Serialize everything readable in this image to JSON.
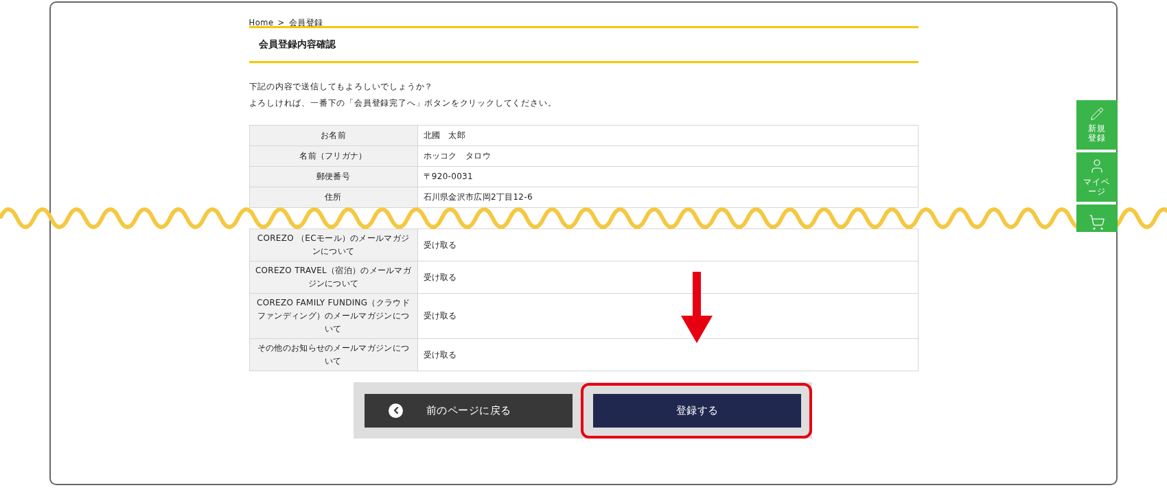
{
  "breadcrumb": {
    "items": [
      "Home",
      "会員登録"
    ],
    "separator": ">"
  },
  "page_title": "会員登録内容確認",
  "intro": [
    "下記の内容で送信してもよろしいでしょうか？",
    "よろしければ、一番下の「会員登録完了へ」ボタンをクリックしてください。"
  ],
  "table": {
    "rows": [
      {
        "label": "お名前",
        "value": "北國　太郎"
      },
      {
        "label": "名前（フリガナ）",
        "value": "ホッコク　タロウ"
      },
      {
        "label": "郵便番号",
        "value": "〒920-0031"
      },
      {
        "label": "住所",
        "value": "石川県金沢市広岡2丁目12-6"
      },
      {
        "label": "COREZO （ECモール）のメールマガジンについて",
        "value": "受け取る"
      },
      {
        "label": "COREZO TRAVEL（宿泊）のメールマガジンについて",
        "value": "受け取る"
      },
      {
        "label": "COREZO FAMILY FUNDING（クラウドファンディング）のメールマガジンについて",
        "value": "受け取る"
      },
      {
        "label": "その他のお知らせのメールマガジンについて",
        "value": "受け取る"
      }
    ]
  },
  "buttons": [
    {
      "kind": "back",
      "label": "前のページに戻る",
      "highlighted": false
    },
    {
      "kind": "submit",
      "label": "登録する",
      "highlighted": true
    }
  ],
  "side_tabs": [
    {
      "kind": "register",
      "label": "新規登録"
    },
    {
      "kind": "mypage",
      "label": "マイページ"
    },
    {
      "kind": "cart"
    }
  ]
}
